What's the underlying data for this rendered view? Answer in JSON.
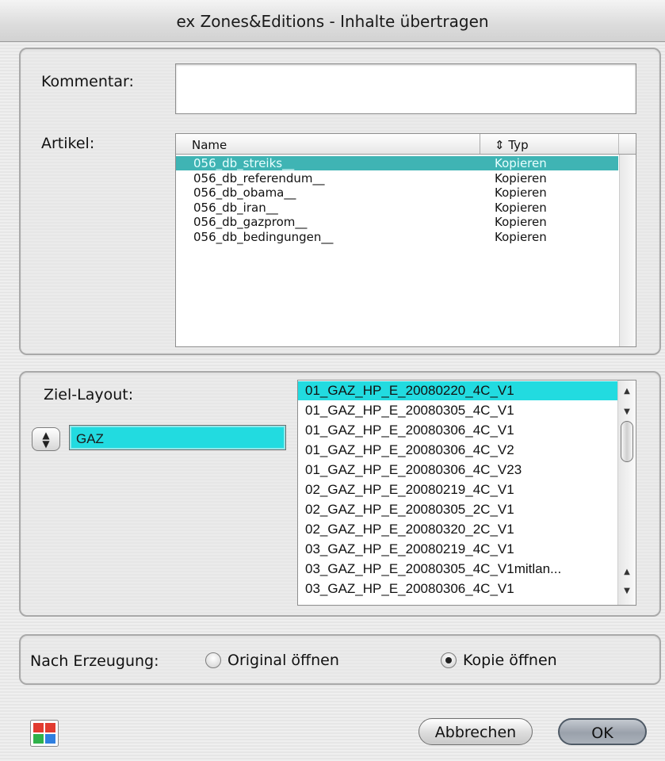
{
  "window": {
    "title": "ex Zones&Editions - Inhalte übertragen"
  },
  "comment": {
    "label": "Kommentar:",
    "value": ""
  },
  "articles": {
    "label": "Artikel:",
    "columns": {
      "name": "Name",
      "type": "Typ",
      "sort_icon": "up-down-sort-icon"
    },
    "rows": [
      {
        "name": "056_db_streiks__",
        "type": "Kopieren",
        "selected": true
      },
      {
        "name": "056_db_referendum__",
        "type": "Kopieren"
      },
      {
        "name": "056_db_obama__",
        "type": "Kopieren"
      },
      {
        "name": "056_db_iran__",
        "type": "Kopieren"
      },
      {
        "name": "056_db_gazprom__",
        "type": "Kopieren"
      },
      {
        "name": "056_db_bedingungen__",
        "type": "Kopieren"
      }
    ]
  },
  "target_layout": {
    "label": "Ziel-Layout:",
    "field_value": "GAZ",
    "popup_icon": "up-down-stepper-icon",
    "items": [
      "01_GAZ_HP_E_20080220_4C_V1",
      "01_GAZ_HP_E_20080305_4C_V1",
      "01_GAZ_HP_E_20080306_4C_V1",
      "01_GAZ_HP_E_20080306_4C_V2",
      "01_GAZ_HP_E_20080306_4C_V23",
      "02_GAZ_HP_E_20080219_4C_V1",
      "02_GAZ_HP_E_20080305_2C_V1",
      "02_GAZ_HP_E_20080320_2C_V1",
      "03_GAZ_HP_E_20080219_4C_V1",
      "03_GAZ_HP_E_20080305_4C_V1mitlan...",
      "03_GAZ_HP_E_20080306_4C_V1"
    ],
    "selected_index": 0
  },
  "after_creation": {
    "label": "Nach Erzeugung:",
    "options": [
      {
        "label": "Original öffnen",
        "checked": false
      },
      {
        "label": "Kopie öffnen",
        "checked": true
      }
    ]
  },
  "buttons": {
    "cancel": "Abbrechen",
    "ok": "OK"
  },
  "colors": {
    "selection_article": "#3fb4b4",
    "selection_layout": "#22dbe0"
  }
}
